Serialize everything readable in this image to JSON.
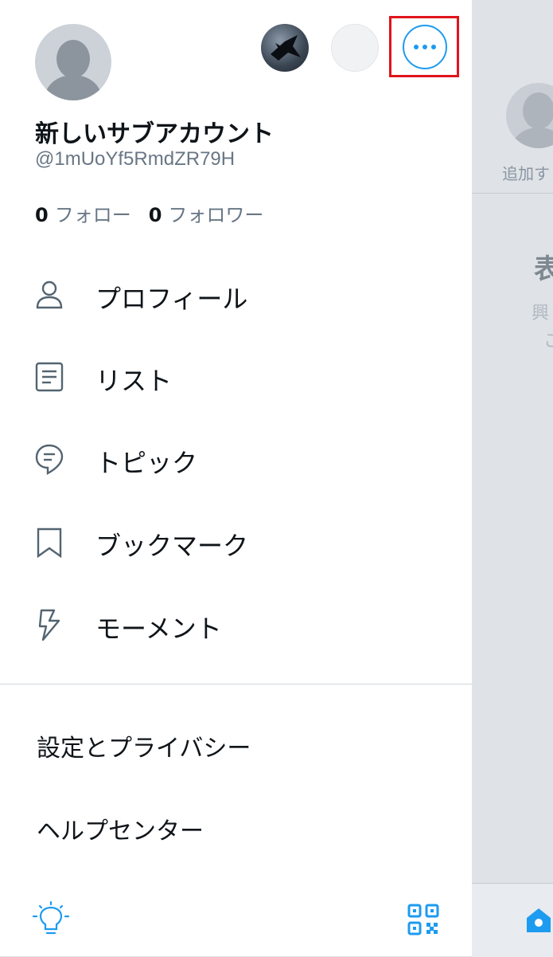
{
  "background": {
    "add_account_text": "追加す",
    "title_fragment": "表",
    "subtitle_line1": "興",
    "subtitle_line2": "こ"
  },
  "drawer": {
    "display_name": "新しいサブアカウント",
    "handle": "@1mUoYf5RmdZR79H",
    "following_count": "0",
    "following_label": "フォロー",
    "followers_count": "0",
    "followers_label": "フォロワー",
    "menu": [
      {
        "label": "プロフィール",
        "icon": "person-icon"
      },
      {
        "label": "リスト",
        "icon": "list-icon"
      },
      {
        "label": "トピック",
        "icon": "topics-icon"
      },
      {
        "label": "ブックマーク",
        "icon": "bookmark-icon"
      },
      {
        "label": "モーメント",
        "icon": "lightning-icon"
      }
    ],
    "secondary": [
      {
        "label": "設定とプライバシー"
      },
      {
        "label": "ヘルプセンター"
      }
    ],
    "bottom_icons": [
      "lightbulb-icon",
      "qr-code-icon"
    ]
  },
  "colors": {
    "accent": "#1d9bf0",
    "highlight_box": "#e0141c",
    "overlay_bg": "#dfe3e8"
  }
}
